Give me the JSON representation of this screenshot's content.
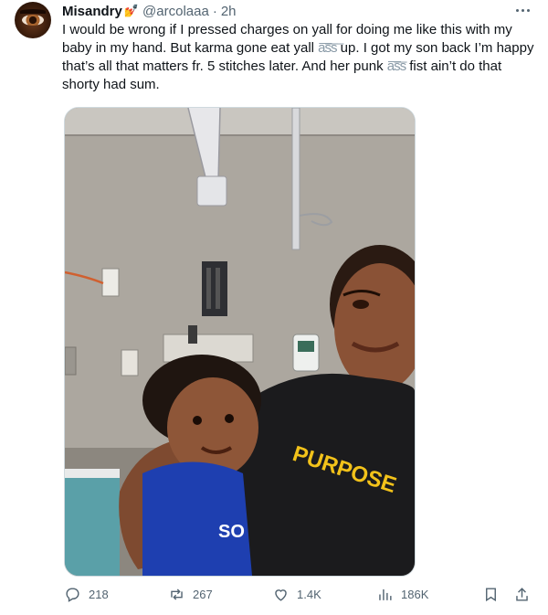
{
  "author": {
    "name": "Misandry",
    "emoji": "💅",
    "handle": "@arcolaaa",
    "separator": "·",
    "time": "2h"
  },
  "tweet": {
    "text_part1": "I would be wrong if I pressed charges on yall for doing me like this with my baby in my hand. But karma gone eat yall ",
    "censor1": "a͞s͞s͞",
    "text_part2": " up. I got my son back I’m happy that’s all that matters fr. 5 stitches later. And her punk ",
    "censor2": "a͞s͞s",
    "text_part3": " fist ain’t do that shorty had sum."
  },
  "media": {
    "shirt_text": "PURPOSE",
    "sleeve_text": "SO"
  },
  "actions": {
    "replies": "218",
    "reposts": "267",
    "likes": "1.4K",
    "views": "186K"
  },
  "icons": [
    "more-icon",
    "reply-icon",
    "repost-icon",
    "like-icon",
    "views-icon",
    "bookmark-icon",
    "share-icon"
  ],
  "colors": {
    "text": "#0f1419",
    "secondary": "#536471",
    "border": "#cfd9de",
    "shirt_text": "#f2c21a"
  }
}
